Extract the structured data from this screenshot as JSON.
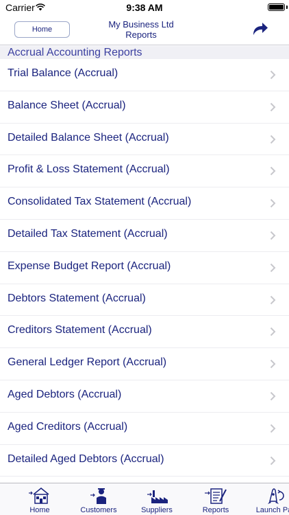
{
  "status_bar": {
    "carrier": "Carrier",
    "time": "9:38 AM"
  },
  "nav": {
    "home_label": "Home",
    "title_line1": "My Business Ltd",
    "title_line2": "Reports"
  },
  "section": {
    "header": "Accrual Accounting Reports"
  },
  "reports": [
    "Trial Balance (Accrual)",
    "Balance Sheet (Accrual)",
    "Detailed Balance Sheet (Accrual)",
    "Profit & Loss Statement (Accrual)",
    "Consolidated Tax Statement (Accrual)",
    "Detailed Tax Statement (Accrual)",
    "Expense Budget Report (Accrual)",
    "Debtors Statement (Accrual)",
    "Creditors Statement (Accrual)",
    "General Ledger Report (Accrual)",
    "Aged Debtors (Accrual)",
    "Aged Creditors (Accrual)",
    "Detailed Aged Debtors (Accrual)"
  ],
  "tabs": [
    {
      "label": "Home",
      "icon": "house-icon"
    },
    {
      "label": "Customers",
      "icon": "customer-icon"
    },
    {
      "label": "Suppliers",
      "icon": "factory-icon"
    },
    {
      "label": "Reports",
      "icon": "report-icon"
    },
    {
      "label": "Launch Pa",
      "icon": "rocket-icon"
    }
  ],
  "colors": {
    "accent": "#1a237e",
    "section_text": "#3b3fa0",
    "section_bg": "#f0f0f5",
    "chevron": "#c7c7cc"
  }
}
